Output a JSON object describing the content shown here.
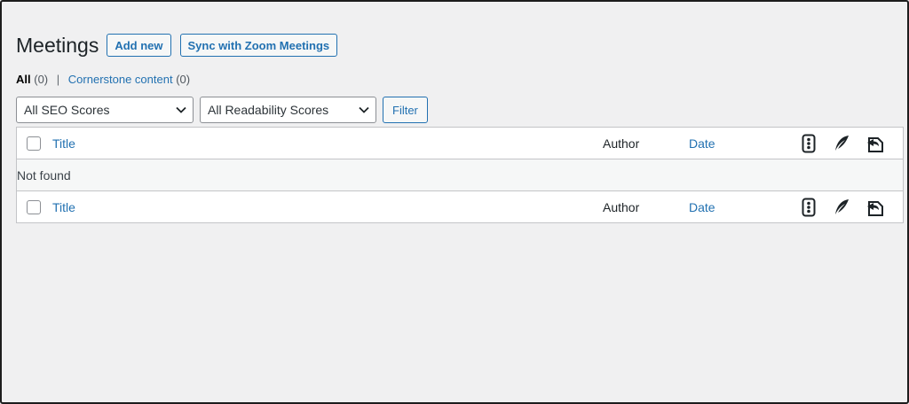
{
  "page": {
    "title": "Meetings",
    "add_new_label": "Add new",
    "sync_label": "Sync with Zoom Meetings"
  },
  "views": {
    "all_label": "All",
    "all_count": "(0)",
    "separator": "|",
    "cornerstone_label": "Cornerstone content",
    "cornerstone_count": "(0)"
  },
  "filters": {
    "seo_select": "All SEO Scores",
    "readability_select": "All Readability Scores",
    "filter_button": "Filter"
  },
  "table": {
    "columns": {
      "title": "Title",
      "author": "Author",
      "date": "Date"
    },
    "icons": [
      "seo-score-icon",
      "readability-feather-icon",
      "internal-links-icon"
    ],
    "empty_message": "Not found"
  },
  "colors": {
    "accent": "#2271b1",
    "background": "#f0f0f1",
    "border": "#c3c4c7"
  }
}
